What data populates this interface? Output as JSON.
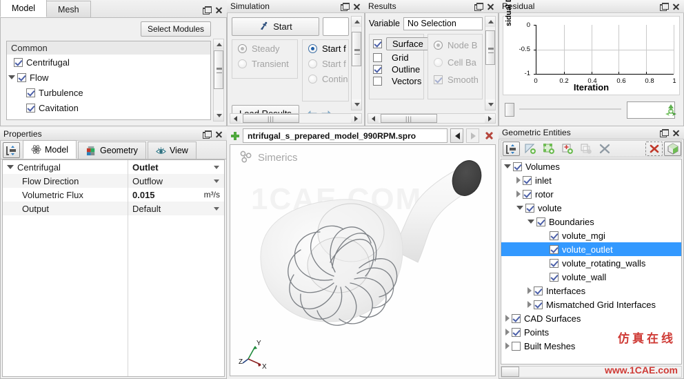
{
  "model_panel": {
    "tabs": [
      {
        "label": "Model",
        "active": true
      },
      {
        "label": "Mesh",
        "active": false
      }
    ],
    "select_modules_label": "Select Modules",
    "group_header": "Common",
    "items": [
      {
        "label": "Centrifugal",
        "checked": true,
        "indent": 1,
        "expander": "none"
      },
      {
        "label": "Flow",
        "checked": true,
        "indent": 1,
        "expander": "down"
      },
      {
        "label": "Turbulence",
        "checked": true,
        "indent": 2,
        "expander": "none"
      },
      {
        "label": "Cavitation",
        "checked": true,
        "indent": 2,
        "expander": "none"
      }
    ]
  },
  "simulation_panel": {
    "title": "Simulation",
    "start_button": "Start",
    "start_icon": "runner-icon",
    "mode_options": [
      {
        "label": "Steady",
        "selected": true,
        "disabled": true
      },
      {
        "label": "Transient",
        "selected": false,
        "disabled": true
      }
    ],
    "run_options": [
      {
        "label": "Start f",
        "selected": true,
        "disabled": false
      },
      {
        "label": "Start f",
        "selected": false,
        "disabled": true
      },
      {
        "label": "Contin",
        "selected": false,
        "disabled": true
      }
    ],
    "load_results_label": "Load Results"
  },
  "results_panel": {
    "title": "Results",
    "variable_label": "Variable",
    "variable_value": "No Selection",
    "display_options": [
      {
        "label": "Surface",
        "checked": true,
        "highlighted": true
      },
      {
        "label": "Grid",
        "checked": false,
        "highlighted": false
      },
      {
        "label": "Outline",
        "checked": true,
        "highlighted": false
      },
      {
        "label": "Vectors",
        "checked": false,
        "highlighted": false
      }
    ],
    "basis_options": [
      {
        "label": "Node B",
        "selected": true,
        "disabled": true
      },
      {
        "label": "Cell Ba",
        "selected": false,
        "disabled": true
      }
    ],
    "smooth_label": "Smooth",
    "smooth_checked": true
  },
  "residual_panel": {
    "title": "Residual",
    "input_value": "",
    "refresh_icon": "recycle-icon"
  },
  "chart_data": {
    "type": "line",
    "title": "",
    "xlabel": "Iteration",
    "ylabel": "sidual Dr",
    "xticks": [
      "0",
      "0.2",
      "0.4",
      "0.6",
      "0.8",
      "1"
    ],
    "yticks": [
      "0",
      "-0.5",
      "-1"
    ],
    "xlim": [
      0,
      1
    ],
    "ylim": [
      -1,
      0
    ],
    "grid": true,
    "series": [],
    "note": "empty plot, no data curves drawn"
  },
  "properties_panel": {
    "title": "Properties",
    "toolbar_icon": "align-icon",
    "tabs": [
      {
        "label": "Model",
        "icon": "atom-icon",
        "active": true
      },
      {
        "label": "Geometry",
        "icon": "cube-icon",
        "active": false
      },
      {
        "label": "View",
        "icon": "eye-icon",
        "active": false
      }
    ],
    "rows": [
      {
        "name": "Centrifugal",
        "value": "Outlet",
        "bold": true,
        "expander": "down",
        "control": "dropdown",
        "unit": ""
      },
      {
        "name": "Flow Direction",
        "value": "Outflow",
        "bold": false,
        "expander": "none",
        "control": "dropdown",
        "unit": ""
      },
      {
        "name": "Volumetric Flux",
        "value": "0.015",
        "bold": true,
        "expander": "none",
        "control": "text",
        "unit": "m³/s"
      },
      {
        "name": "Output",
        "value": "Default",
        "bold": false,
        "expander": "none",
        "control": "dropdown",
        "unit": ""
      }
    ]
  },
  "viewport": {
    "add_icon": "plus-icon",
    "tab_label": "ntrifugal_s_prepared_model_990RPM.spro",
    "prev_icon": "prev-arrow-icon",
    "next_icon": "next-arrow-icon",
    "close_icon": "close-tab-icon",
    "brand": "Simerics",
    "brand_icon": "simerics-logo-icon",
    "watermark": "1CAE.COM",
    "axes": {
      "x": "X",
      "y": "Y",
      "z": "Z"
    }
  },
  "geometric_entities": {
    "title": "Geometric Entities",
    "toolbar": [
      {
        "name": "align-icon",
        "framed": true
      },
      {
        "name": "add-face-icon",
        "framed": false
      },
      {
        "name": "add-group-icon",
        "framed": false
      },
      {
        "name": "add-point-icon",
        "framed": false
      },
      {
        "name": "add-box-icon",
        "framed": false
      },
      {
        "name": "delete-x-icon",
        "framed": false
      },
      {
        "name": "hide-selection-icon",
        "framed": false
      },
      {
        "name": "show-solid-icon",
        "framed": true
      }
    ],
    "tree": [
      {
        "label": "Volumes",
        "checked": true,
        "indent": 0,
        "expander": "down",
        "selected": false
      },
      {
        "label": "inlet",
        "checked": true,
        "indent": 1,
        "expander": "right",
        "selected": false
      },
      {
        "label": "rotor",
        "checked": true,
        "indent": 1,
        "expander": "right",
        "selected": false
      },
      {
        "label": "volute",
        "checked": true,
        "indent": 1,
        "expander": "down",
        "selected": false
      },
      {
        "label": "Boundaries",
        "checked": true,
        "indent": 2,
        "expander": "down",
        "selected": false
      },
      {
        "label": "volute_mgi",
        "checked": true,
        "indent": 3,
        "expander": "none",
        "selected": false
      },
      {
        "label": "volute_outlet",
        "checked": true,
        "indent": 3,
        "expander": "none",
        "selected": true
      },
      {
        "label": "volute_rotating_walls",
        "checked": true,
        "indent": 3,
        "expander": "none",
        "selected": false
      },
      {
        "label": "volute_wall",
        "checked": true,
        "indent": 3,
        "expander": "none",
        "selected": false
      },
      {
        "label": "Interfaces",
        "checked": true,
        "indent": 2,
        "expander": "right",
        "selected": false
      },
      {
        "label": "Mismatched Grid Interfaces",
        "checked": true,
        "indent": 2,
        "expander": "right",
        "selected": false
      },
      {
        "label": "CAD Surfaces",
        "checked": true,
        "indent": 0,
        "expander": "right",
        "selected": false
      },
      {
        "label": "Points",
        "checked": true,
        "indent": 0,
        "expander": "right",
        "selected": false
      },
      {
        "label": "Built Meshes",
        "checked": false,
        "indent": 0,
        "expander": "right",
        "selected": false
      }
    ],
    "watermark_cn": "仿真在线",
    "watermark_url": "www.1CAE.com"
  },
  "colors": {
    "selection_blue": "#3399ff",
    "check_blue": "#4b5fa8",
    "watermark_red": "#cf3b36",
    "panel_bg": "#f0f0f0",
    "accent_green": "#4fa83d"
  }
}
